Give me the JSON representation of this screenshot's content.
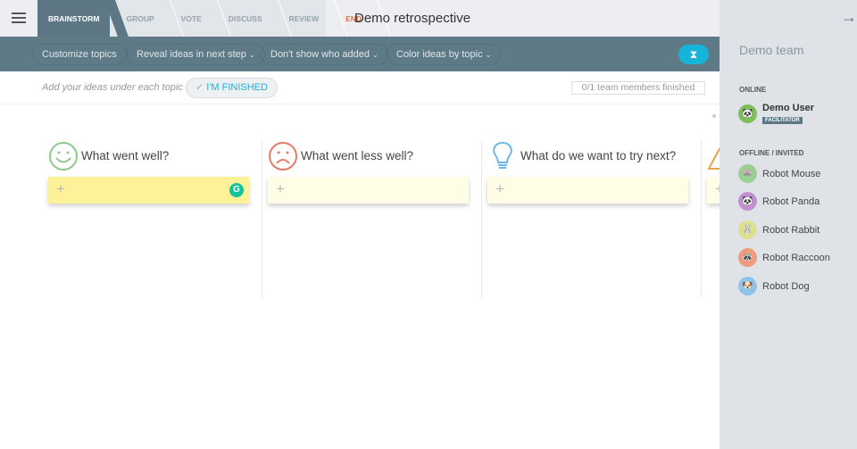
{
  "header": {
    "menu_icon": "hamburger-icon",
    "title": "Demo retrospective",
    "steps": [
      {
        "label": "BRAINSTORM",
        "active": true
      },
      {
        "label": "GROUP"
      },
      {
        "label": "VOTE"
      },
      {
        "label": "DISCUSS"
      },
      {
        "label": "REVIEW"
      },
      {
        "label": "END",
        "color": "#e8703e"
      }
    ]
  },
  "toolbar": {
    "customize": "Customize topics",
    "reveal": "Reveal ideas in next step",
    "show_who": "Don't show who added",
    "color_ideas": "Color ideas by topic",
    "dropdown_glyph": "⌄",
    "timer_icon": "hourglass-icon",
    "timer_glyph": "⧗"
  },
  "info": {
    "hint": "Add your ideas under each topic",
    "finished_button": "I'M FINISHED",
    "check": "✓",
    "count": "0/1 team members finished"
  },
  "topics": [
    {
      "title": "What went well?",
      "icon": "smiley-icon",
      "color": "#8fc98f"
    },
    {
      "title": "What went less well?",
      "icon": "sad-face-icon",
      "color": "#e57b69"
    },
    {
      "title": "What do we want to try next?",
      "icon": "lightbulb-icon",
      "color": "#6db7e6"
    },
    {
      "title": "",
      "icon": "warning-icon",
      "color": "#e7a54d"
    }
  ],
  "card": {
    "plus": "+",
    "grammarly": "G"
  },
  "sidebar": {
    "collapse_glyph": "→|",
    "team": "Demo team",
    "online_heading": "ONLINE",
    "offline_heading": "OFFLINE / INVITED",
    "online": [
      {
        "name": "Demo User",
        "badge": "FACILITATOR",
        "color": "#7fbf5a"
      }
    ],
    "offline": [
      {
        "name": "Robot Mouse",
        "color": "#9ccf93"
      },
      {
        "name": "Robot Panda",
        "color": "#c08fd4"
      },
      {
        "name": "Robot Rabbit",
        "color": "#dfe08f"
      },
      {
        "name": "Robot Raccoon",
        "color": "#ee9a7b"
      },
      {
        "name": "Robot Dog",
        "color": "#8fc3ea"
      }
    ]
  }
}
